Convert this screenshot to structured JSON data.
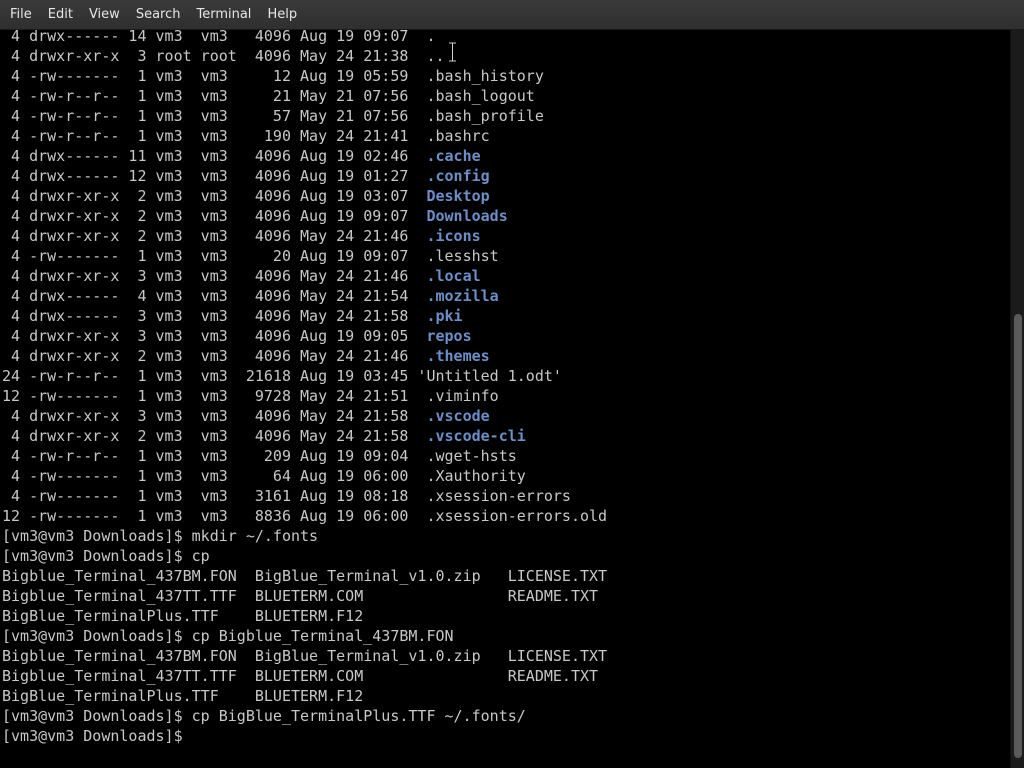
{
  "menu": [
    "File",
    "Edit",
    "View",
    "Search",
    "Terminal",
    "Help"
  ],
  "listing": [
    {
      "prefix": " 4 drwx------ 14 vm3  vm3   4096 Aug 19 09:07  ",
      "name": ".",
      "dir": false
    },
    {
      "prefix": " 4 drwxr-xr-x  3 root root  4096 May 24 21:38  ",
      "name": "..",
      "dir": false
    },
    {
      "prefix": " 4 -rw-------  1 vm3  vm3     12 Aug 19 05:59  ",
      "name": ".bash_history",
      "dir": false
    },
    {
      "prefix": " 4 -rw-r--r--  1 vm3  vm3     21 May 21 07:56  ",
      "name": ".bash_logout",
      "dir": false
    },
    {
      "prefix": " 4 -rw-r--r--  1 vm3  vm3     57 May 21 07:56  ",
      "name": ".bash_profile",
      "dir": false
    },
    {
      "prefix": " 4 -rw-r--r--  1 vm3  vm3    190 May 24 21:41  ",
      "name": ".bashrc",
      "dir": false
    },
    {
      "prefix": " 4 drwx------ 11 vm3  vm3   4096 Aug 19 02:46  ",
      "name": ".cache",
      "dir": true
    },
    {
      "prefix": " 4 drwx------ 12 vm3  vm3   4096 Aug 19 01:27  ",
      "name": ".config",
      "dir": true
    },
    {
      "prefix": " 4 drwxr-xr-x  2 vm3  vm3   4096 Aug 19 03:07  ",
      "name": "Desktop",
      "dir": true
    },
    {
      "prefix": " 4 drwxr-xr-x  2 vm3  vm3   4096 Aug 19 09:07  ",
      "name": "Downloads",
      "dir": true
    },
    {
      "prefix": " 4 drwxr-xr-x  2 vm3  vm3   4096 May 24 21:46  ",
      "name": ".icons",
      "dir": true
    },
    {
      "prefix": " 4 -rw-------  1 vm3  vm3     20 Aug 19 09:07  ",
      "name": ".lesshst",
      "dir": false
    },
    {
      "prefix": " 4 drwxr-xr-x  3 vm3  vm3   4096 May 24 21:46  ",
      "name": ".local",
      "dir": true
    },
    {
      "prefix": " 4 drwx------  4 vm3  vm3   4096 May 24 21:54  ",
      "name": ".mozilla",
      "dir": true
    },
    {
      "prefix": " 4 drwx------  3 vm3  vm3   4096 May 24 21:58  ",
      "name": ".pki",
      "dir": true
    },
    {
      "prefix": " 4 drwxr-xr-x  3 vm3  vm3   4096 Aug 19 09:05  ",
      "name": "repos",
      "dir": true
    },
    {
      "prefix": " 4 drwxr-xr-x  2 vm3  vm3   4096 May 24 21:46  ",
      "name": ".themes",
      "dir": true
    },
    {
      "prefix": "24 -rw-r--r--  1 vm3  vm3  21618 Aug 19 03:45 ",
      "name": "'Untitled 1.odt'",
      "dir": false
    },
    {
      "prefix": "12 -rw-------  1 vm3  vm3   9728 May 24 21:51  ",
      "name": ".viminfo",
      "dir": false
    },
    {
      "prefix": " 4 drwxr-xr-x  3 vm3  vm3   4096 May 24 21:58  ",
      "name": ".vscode",
      "dir": true
    },
    {
      "prefix": " 4 drwxr-xr-x  2 vm3  vm3   4096 May 24 21:58  ",
      "name": ".vscode-cli",
      "dir": true
    },
    {
      "prefix": " 4 -rw-r--r--  1 vm3  vm3    209 Aug 19 09:04  ",
      "name": ".wget-hsts",
      "dir": false
    },
    {
      "prefix": " 4 -rw-------  1 vm3  vm3     64 Aug 19 06:00  ",
      "name": ".Xauthority",
      "dir": false
    },
    {
      "prefix": " 4 -rw-------  1 vm3  vm3   3161 Aug 19 08:18  ",
      "name": ".xsession-errors",
      "dir": false
    },
    {
      "prefix": "12 -rw-------  1 vm3  vm3   8836 Aug 19 06:00  ",
      "name": ".xsession-errors.old",
      "dir": false
    }
  ],
  "session": [
    "[vm3@vm3 Downloads]$ mkdir ~/.fonts",
    "[vm3@vm3 Downloads]$ cp",
    "Bigblue_Terminal_437BM.FON  BigBlue_Terminal_v1.0.zip   LICENSE.TXT",
    "Bigblue_Terminal_437TT.TTF  BLUETERM.COM                README.TXT",
    "BigBlue_TerminalPlus.TTF    BLUETERM.F12",
    "[vm3@vm3 Downloads]$ cp Bigblue_Terminal_437BM.FON",
    "Bigblue_Terminal_437BM.FON  BigBlue_Terminal_v1.0.zip   LICENSE.TXT",
    "Bigblue_Terminal_437TT.TTF  BLUETERM.COM                README.TXT",
    "BigBlue_TerminalPlus.TTF    BLUETERM.F12",
    "[vm3@vm3 Downloads]$ cp BigBlue_TerminalPlus.TTF ~/.fonts/",
    "[vm3@vm3 Downloads]$ "
  ],
  "colors": {
    "text": "#c8c8c8",
    "directory": "#6d8fc9",
    "background": "#000000",
    "menubar": "#333333"
  },
  "scroll_position_fraction": 0.38
}
